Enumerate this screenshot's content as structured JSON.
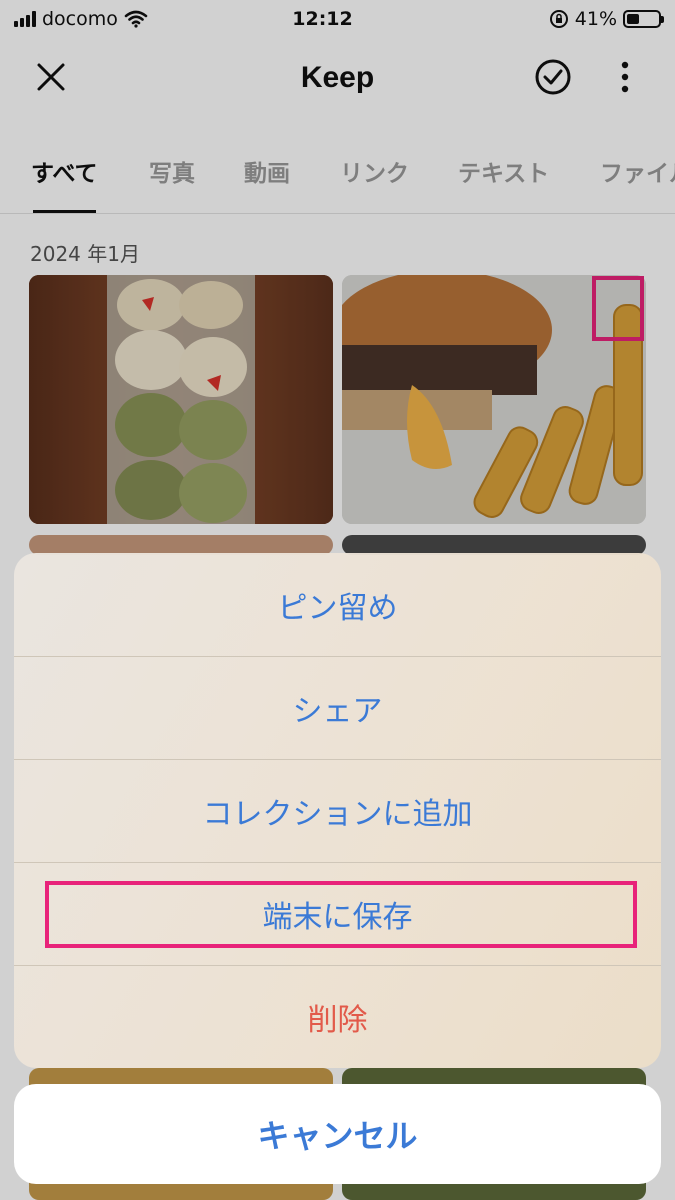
{
  "status_bar": {
    "carrier": "docomo",
    "time": "12:12",
    "battery": "41%",
    "battery_level": 0.41
  },
  "header": {
    "title": "Keep"
  },
  "tabs": [
    {
      "label": "すべて",
      "active": true
    },
    {
      "label": "写真",
      "active": false
    },
    {
      "label": "動画",
      "active": false
    },
    {
      "label": "リンク",
      "active": false
    },
    {
      "label": "テキスト",
      "active": false
    },
    {
      "label": "ファイル",
      "active": false
    }
  ],
  "date_label": "2024 年1月",
  "action_sheet": {
    "items": [
      {
        "label": "ピン留め"
      },
      {
        "label": "シェア"
      },
      {
        "label": "コレクションに追加"
      },
      {
        "label": "端末に保存"
      },
      {
        "label": "削除"
      }
    ],
    "cancel_label": "キャンセル"
  },
  "colors": {
    "accent": "#3b7ad6",
    "destructive": "#e25a4a",
    "highlight": "#e8237a"
  },
  "icons": [
    "signal-icon",
    "wifi-icon",
    "rotation-lock-icon",
    "battery-icon",
    "close-icon",
    "check-circle-icon",
    "more-vertical-icon"
  ]
}
